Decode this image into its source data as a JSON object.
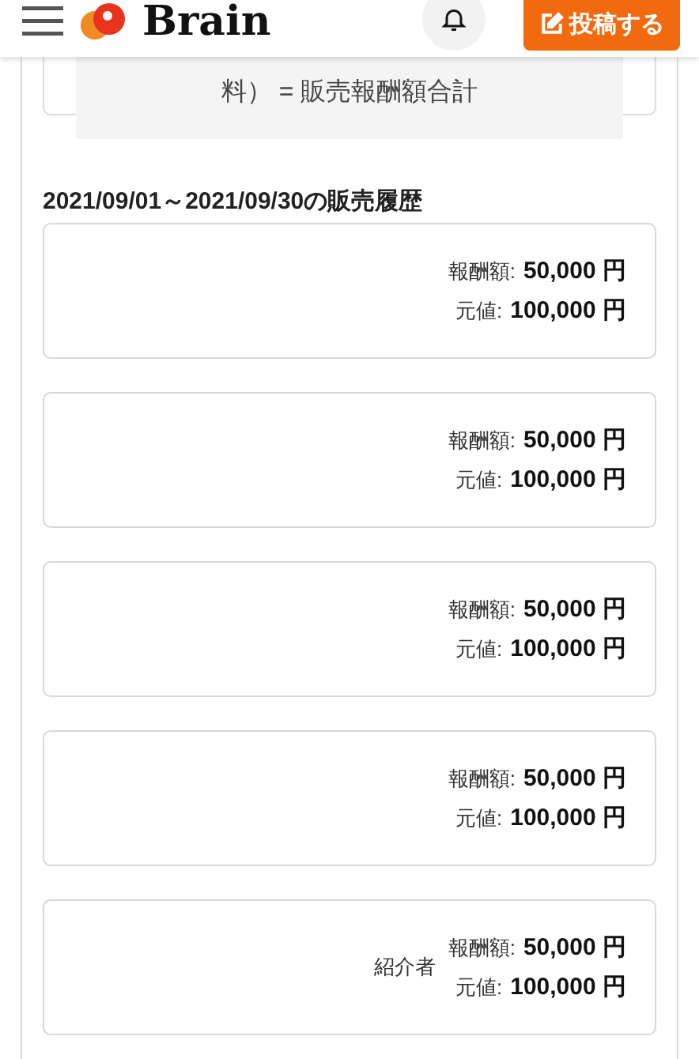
{
  "header": {
    "logo": "Brain",
    "post_button": "投稿する"
  },
  "formula_note": "料） = 販売報酬額合計",
  "history": {
    "title": "2021/09/01～2021/09/30の販売履歴",
    "sales": [
      {
        "reward_label": "報酬額:",
        "reward": "50,000 円",
        "price_label": "元値:",
        "price": "100,000 円"
      },
      {
        "reward_label": "報酬額:",
        "reward": "50,000 円",
        "price_label": "元値:",
        "price": "100,000 円"
      },
      {
        "reward_label": "報酬額:",
        "reward": "50,000 円",
        "price_label": "元値:",
        "price": "100,000 円"
      },
      {
        "reward_label": "報酬額:",
        "reward": "50,000 円",
        "price_label": "元値:",
        "price": "100,000 円"
      },
      {
        "note": "紹介者",
        "reward_label": "報酬額:",
        "reward": "50,000 円",
        "price_label": "元値:",
        "price": "100,000 円"
      }
    ]
  }
}
